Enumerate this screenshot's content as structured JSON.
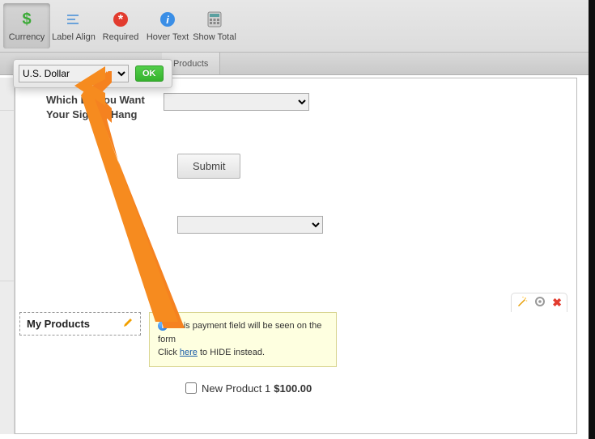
{
  "toolbar": {
    "items": [
      {
        "label": "Currency",
        "name": "currency-tool",
        "active": true
      },
      {
        "label": "Label Align",
        "name": "label-align-tool",
        "active": false
      },
      {
        "label": "Required",
        "name": "required-tool",
        "active": false
      },
      {
        "label": "Hover Text",
        "name": "hover-text-tool",
        "active": false
      },
      {
        "label": "Show Total",
        "name": "show-total-tool",
        "active": false
      }
    ]
  },
  "currency_popup": {
    "selected": "U.S. Dollar",
    "ok_label": "OK"
  },
  "tabs": {
    "products_label": "Products"
  },
  "form": {
    "question_label": "Which         Do You Want Your Sign to Hang",
    "submit_label": "Submit"
  },
  "products": {
    "section_label": "My Products",
    "tooltip_line1": "This payment field will be seen on the form",
    "tooltip_line2_prefix": "Click ",
    "tooltip_line2_link": "here",
    "tooltip_line2_suffix": " to HIDE instead.",
    "item": {
      "name": "New Product 1",
      "price": "$100.00"
    }
  }
}
